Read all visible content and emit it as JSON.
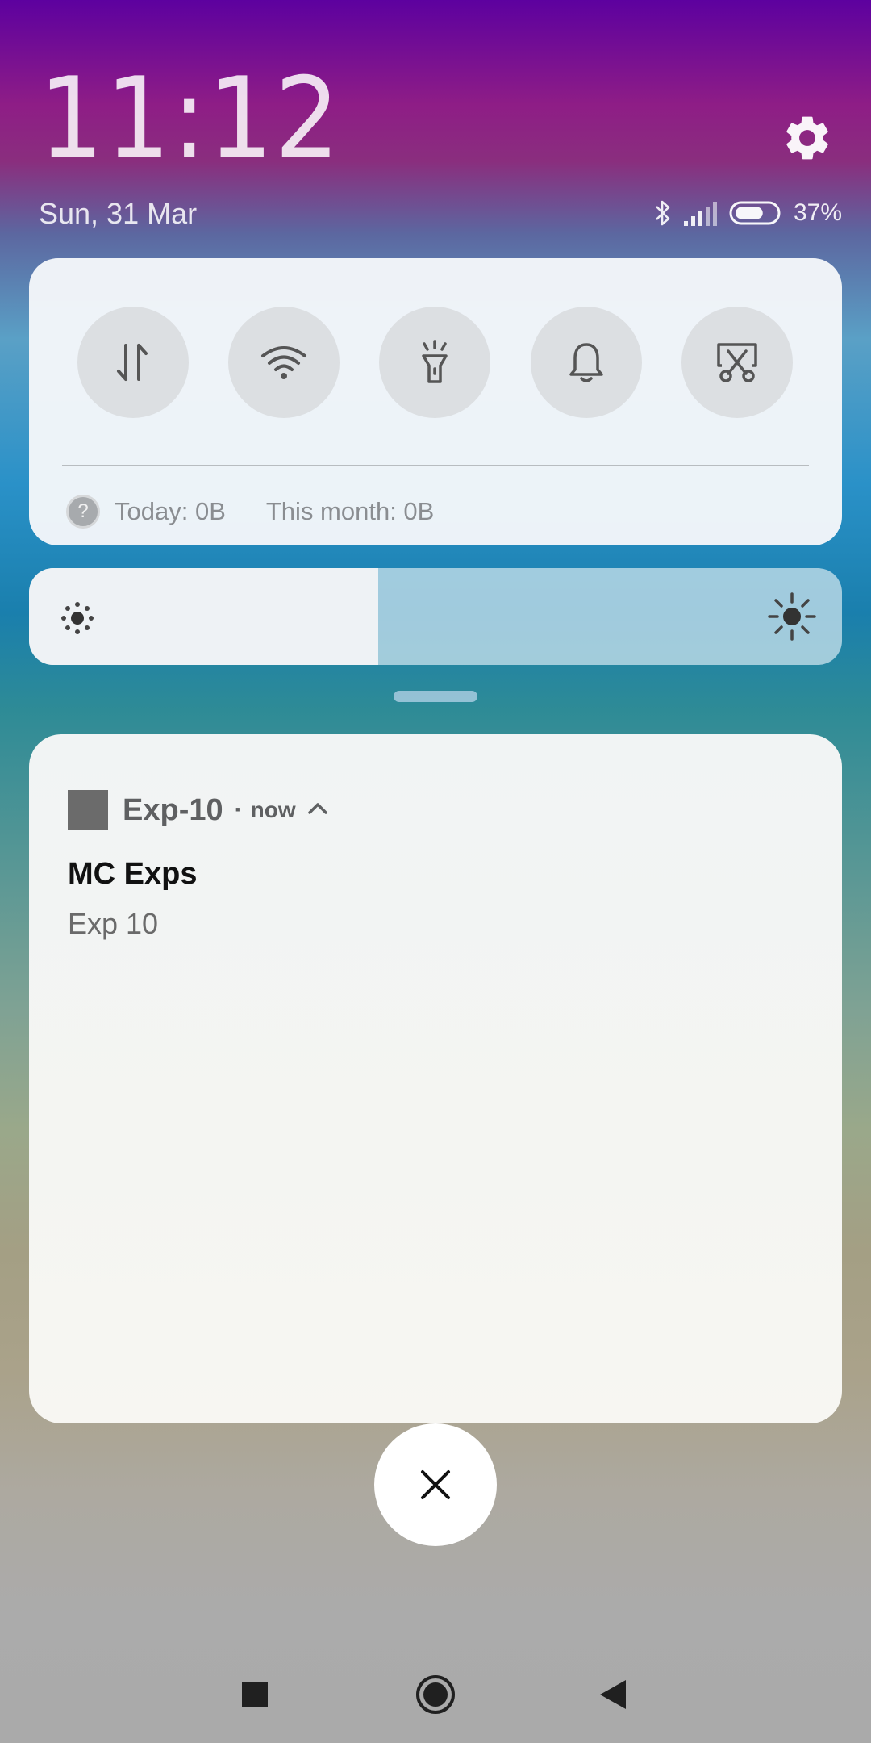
{
  "lockscreen": {
    "time": "11:12",
    "date": "Sun, 31 Mar"
  },
  "status_bar": {
    "battery_percent": "37%",
    "battery_level": 0.37,
    "icons": [
      "bluetooth-icon",
      "signal-icon",
      "battery-icon"
    ]
  },
  "quick_settings": {
    "toggles": [
      {
        "name": "mobile-data",
        "icon": "arrows-updown-icon"
      },
      {
        "name": "wifi",
        "icon": "wifi-icon"
      },
      {
        "name": "flashlight",
        "icon": "flashlight-icon"
      },
      {
        "name": "sound",
        "icon": "bell-icon"
      },
      {
        "name": "screenshot",
        "icon": "scissors-icon"
      }
    ],
    "data_usage": {
      "today": "Today: 0B",
      "month": "This month: 0B"
    }
  },
  "brightness": {
    "level": 0.43
  },
  "notification": {
    "app_name": "Exp-10",
    "separator": "·",
    "time": "now",
    "title": "MC Exps",
    "text": "Exp 10"
  },
  "colors": {
    "panel_bg": "#f5f7fa",
    "toggle_bg": "#dcdfe2",
    "icon_dark": "#555555",
    "app_icon": "#6b6b6b"
  }
}
